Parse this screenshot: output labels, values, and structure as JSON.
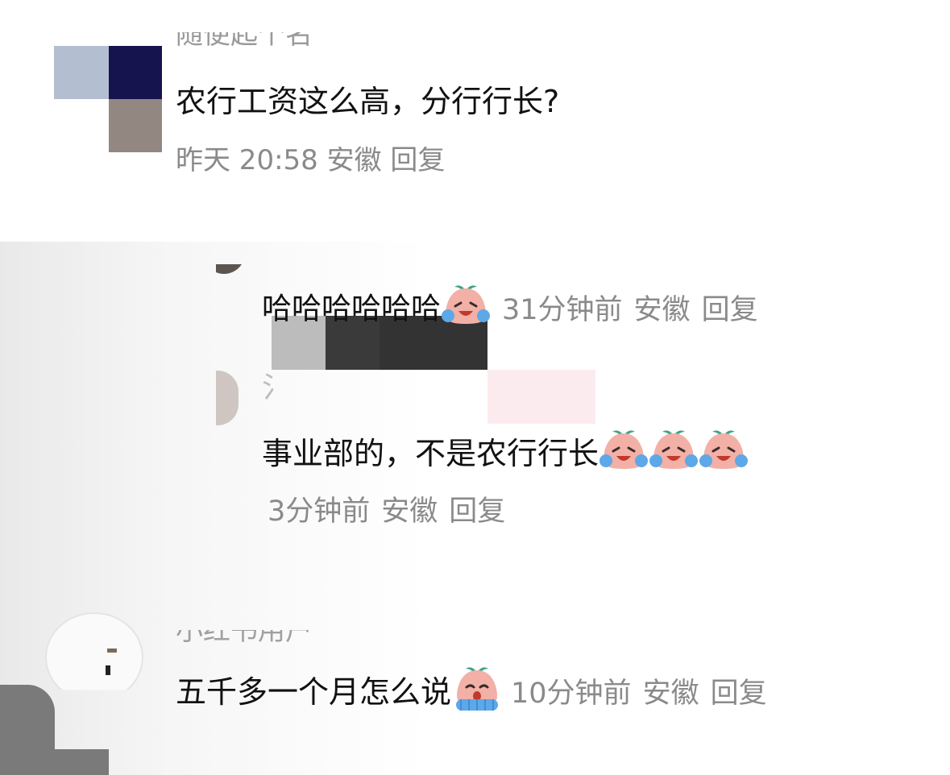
{
  "comment_1": {
    "username_partial": "随便起个名",
    "body": "农行工资这么高，分行行长?",
    "meta_partial": "昨天 20:58 安徽 回复"
  },
  "reply_1": {
    "body": "哈哈哈哈哈哈",
    "emoji": "crying-laughing-emoji",
    "time": "31分钟前",
    "location": "安徽",
    "reply_label": "回复"
  },
  "reply_2": {
    "username_partial": "氵",
    "body": "事业部的，不是农行行长",
    "emoji": "crying-laughing-emoji",
    "emoji_count": 3,
    "time": "3分钟前",
    "location": "安徽",
    "reply_label": "回复"
  },
  "comment_3": {
    "username_partial": "小红书用户",
    "body": "五千多一个月怎么说",
    "emoji": "crying-emoji",
    "time": "10分钟前",
    "location": "安徽",
    "reply_label": "回复"
  },
  "colors": {
    "text": "#111111",
    "meta": "#8a8a8a",
    "emoji_face": "#f2b0a6",
    "emoji_leaf": "#3aa58a",
    "emoji_tear": "#5da8e8"
  }
}
